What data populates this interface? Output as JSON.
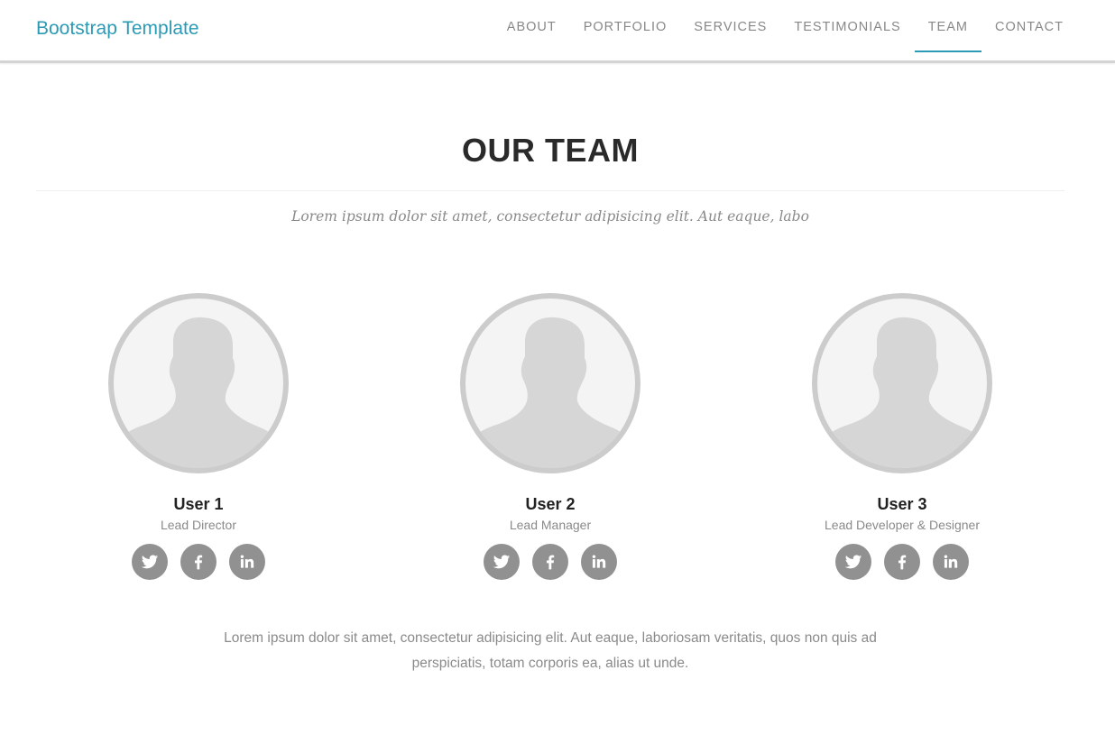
{
  "nav": {
    "brand": "Bootstrap Template",
    "items": [
      {
        "label": "ABOUT",
        "active": false
      },
      {
        "label": "PORTFOLIO",
        "active": false
      },
      {
        "label": "SERVICES",
        "active": false
      },
      {
        "label": "TESTIMONIALS",
        "active": false
      },
      {
        "label": "TEAM",
        "active": true
      },
      {
        "label": "CONTACT",
        "active": false
      }
    ]
  },
  "team": {
    "title": "OUR TEAM",
    "lead": "Lorem ipsum dolor sit amet, consectetur adipisicing elit. Aut eaque, labo",
    "members": [
      {
        "name": "User 1",
        "role": "Lead Director",
        "socials": [
          "twitter-icon",
          "facebook-icon",
          "linkedin-icon"
        ]
      },
      {
        "name": "User 2",
        "role": "Lead Manager",
        "socials": [
          "twitter-icon",
          "facebook-icon",
          "linkedin-icon"
        ]
      },
      {
        "name": "User 3",
        "role": "Lead Developer & Designer",
        "socials": [
          "twitter-icon",
          "facebook-icon",
          "linkedin-icon"
        ]
      }
    ],
    "footer": "Lorem ipsum dolor sit amet, consectetur adipisicing elit. Aut eaque, laboriosam veritatis, quos non quis ad perspiciatis, totam corporis ea, alias ut unde."
  },
  "colors": {
    "accent": "#2b9ab4",
    "social_bg": "#919191",
    "avatar_border": "#cccccc"
  }
}
